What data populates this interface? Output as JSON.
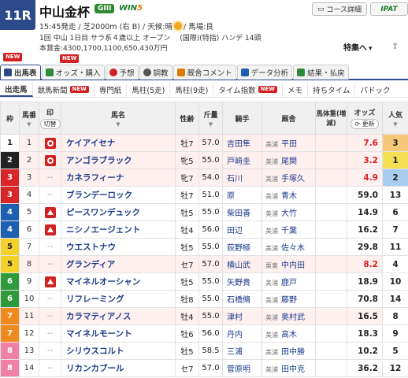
{
  "race": {
    "number": "11R",
    "title": "中山金杯",
    "grade": "GIII",
    "win5_a": "WIN",
    "win5_b": "5",
    "meta1_pre": "15:45発走 / 芝2000m (右 B) / 天候:晴",
    "meta1_post": "/ 馬場:良",
    "meta2": "1回 中山 1日目 サラ系４歳以上 オープン　 (国際)(特指) ハンデ 14頭",
    "meta3": "本賞金:4300,1700,1100,650,430万円"
  },
  "header_buttons": {
    "course": "コース詳細",
    "ipat": "IPAT",
    "tokushu": "特集へ",
    "share": "⇪"
  },
  "badges": {
    "new": "NEW"
  },
  "tabs": [
    {
      "label": "出馬表",
      "color": "#2c4a8a"
    },
    {
      "label": "オッズ・購入",
      "color": "#2c8a3a"
    },
    {
      "label": "予想",
      "color": "#d32020"
    },
    {
      "label": "調教",
      "color": "#555555"
    },
    {
      "label": "厩舎コメント",
      "color": "#e07a00"
    },
    {
      "label": "データ分析",
      "color": "#1d5fb0"
    },
    {
      "label": "結果・払戻",
      "color": "#2c8a3a"
    }
  ],
  "subtabs": [
    {
      "label": "出走馬",
      "new": ""
    },
    {
      "label": "競馬新聞",
      "new": "NEW"
    },
    {
      "label": "専門紙",
      "new": ""
    },
    {
      "label": "馬柱(5走)",
      "new": ""
    },
    {
      "label": "馬柱(9走)",
      "new": ""
    },
    {
      "label": "タイム指数",
      "new": "NEW"
    },
    {
      "label": "メモ",
      "new": ""
    },
    {
      "label": "持ちタイム",
      "new": ""
    },
    {
      "label": "パドック",
      "new": ""
    }
  ],
  "columns": {
    "waku": "枠",
    "umaban": "馬番",
    "mark": "印",
    "mark_sub": "切替",
    "name": "馬名",
    "sex": "性齢",
    "kinryo": "斤量",
    "jockey": "騎手",
    "trainer": "厩舎",
    "weight": "馬体重(増減)",
    "odds": "オッズ",
    "odds_btn": "更新",
    "pop": "人気",
    "sort": "▼"
  },
  "rows": [
    {
      "waku": "1",
      "uma": "1",
      "mark": "circ",
      "name": "ケイアイセナ",
      "sex": "牡7",
      "kin": "57.0",
      "jockey": "吉田隼",
      "area": "美浦",
      "trainer": "平田",
      "weight": "",
      "odds": "7.6",
      "hot": true,
      "pop": "3",
      "hl": true
    },
    {
      "waku": "2",
      "uma": "2",
      "mark": "circ",
      "name": "アンゴラブラック",
      "sex": "牝5",
      "kin": "55.0",
      "jockey": "戸崎圭",
      "area": "美浦",
      "trainer": "尾関",
      "weight": "",
      "odds": "3.2",
      "hot": true,
      "pop": "1",
      "hl": true
    },
    {
      "waku": "3",
      "uma": "3",
      "mark": "empty",
      "name": "カネラフィーナ",
      "sex": "牝7",
      "kin": "54.0",
      "jockey": "石川",
      "area": "美浦",
      "trainer": "手塚久",
      "weight": "",
      "odds": "4.9",
      "hot": true,
      "pop": "2",
      "hl": true
    },
    {
      "waku": "3",
      "uma": "4",
      "mark": "empty",
      "name": "ブランデーロック",
      "sex": "牡7",
      "kin": "51.0",
      "jockey": "原",
      "area": "美浦",
      "trainer": "青木",
      "weight": "",
      "odds": "59.0",
      "hot": false,
      "pop": "13",
      "hl": false
    },
    {
      "waku": "4",
      "uma": "5",
      "mark": "tri",
      "name": "ピースワンデュック",
      "sex": "牡5",
      "kin": "55.0",
      "jockey": "柴田善",
      "area": "美浦",
      "trainer": "大竹",
      "weight": "",
      "odds": "14.9",
      "hot": false,
      "pop": "6",
      "hl": false
    },
    {
      "waku": "4",
      "uma": "6",
      "mark": "tri",
      "name": "ニシノエージェント",
      "sex": "牡4",
      "kin": "56.0",
      "jockey": "田辺",
      "area": "美浦",
      "trainer": "千葉",
      "weight": "",
      "odds": "16.2",
      "hot": false,
      "pop": "7",
      "hl": false
    },
    {
      "waku": "5",
      "uma": "7",
      "mark": "empty",
      "name": "ウエストナウ",
      "sex": "牡5",
      "kin": "55.0",
      "jockey": "荻野極",
      "area": "美浦",
      "trainer": "佐々木",
      "weight": "",
      "odds": "29.8",
      "hot": false,
      "pop": "11",
      "hl": false
    },
    {
      "waku": "5",
      "uma": "8",
      "mark": "empty",
      "name": "グランディア",
      "sex": "セ7",
      "kin": "57.0",
      "jockey": "横山武",
      "area": "栗東",
      "trainer": "中内田",
      "weight": "",
      "odds": "8.2",
      "hot": true,
      "pop": "4",
      "hl": true
    },
    {
      "waku": "6",
      "uma": "9",
      "mark": "tri",
      "name": "マイネルオーシャン",
      "sex": "牡5",
      "kin": "55.0",
      "jockey": "矢野貴",
      "area": "美浦",
      "trainer": "鹿戸",
      "weight": "",
      "odds": "18.9",
      "hot": false,
      "pop": "10",
      "hl": false
    },
    {
      "waku": "6",
      "uma": "10",
      "mark": "empty",
      "name": "リフレーミング",
      "sex": "牡8",
      "kin": "55.0",
      "jockey": "石橋脩",
      "area": "美浦",
      "trainer": "藤野",
      "weight": "",
      "odds": "70.8",
      "hot": false,
      "pop": "14",
      "hl": false
    },
    {
      "waku": "7",
      "uma": "11",
      "mark": "empty",
      "name": "カラマティアノス",
      "sex": "牡4",
      "kin": "55.0",
      "jockey": "津村",
      "area": "美浦",
      "trainer": "奥村武",
      "weight": "",
      "odds": "16.5",
      "hot": false,
      "pop": "8",
      "hl": true
    },
    {
      "waku": "7",
      "uma": "12",
      "mark": "empty",
      "name": "マイネルモーント",
      "sex": "牡6",
      "kin": "56.0",
      "jockey": "丹内",
      "area": "美浦",
      "trainer": "高木",
      "weight": "",
      "odds": "18.3",
      "hot": false,
      "pop": "9",
      "hl": false
    },
    {
      "waku": "8",
      "uma": "13",
      "mark": "empty",
      "name": "シリウスコルト",
      "sex": "牡5",
      "kin": "58.5",
      "jockey": "三浦",
      "area": "美浦",
      "trainer": "田中勝",
      "weight": "",
      "odds": "10.2",
      "hot": false,
      "pop": "5",
      "hl": false
    },
    {
      "waku": "8",
      "uma": "14",
      "mark": "empty",
      "name": "リカンカブール",
      "sex": "セ7",
      "kin": "57.0",
      "jockey": "菅原明",
      "area": "美浦",
      "trainer": "田中克",
      "weight": "",
      "odds": "36.2",
      "hot": false,
      "pop": "12",
      "hl": false
    }
  ]
}
